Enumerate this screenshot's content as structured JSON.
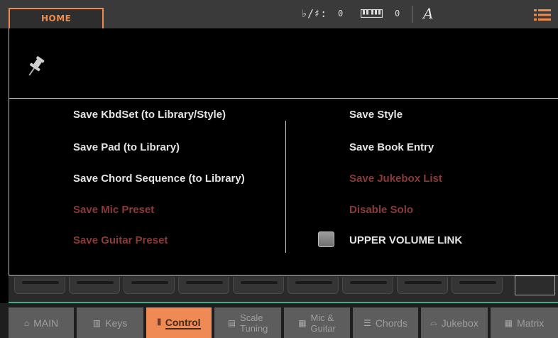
{
  "topbar": {
    "home_tab": "HOME",
    "transpose_label": "♭/♯:",
    "transpose_value": "0",
    "octave_value": "0",
    "scale_letter": "A",
    "icons": [
      "keyboard-icon",
      "menu-list-icon"
    ],
    "accent_color": "#f08b4b"
  },
  "popup": {
    "left_items": [
      {
        "label": "Save KbdSet (to Library/Style)",
        "enabled": true
      },
      {
        "label": "Save Pad (to Library)",
        "enabled": true
      },
      {
        "label": "Save Chord Sequence (to Library)",
        "enabled": true
      },
      {
        "label": "Save Mic Preset",
        "enabled": false
      },
      {
        "label": "Save Guitar Preset",
        "enabled": false
      }
    ],
    "right_items": [
      {
        "label": "Save Style",
        "enabled": true
      },
      {
        "label": "Save Book Entry",
        "enabled": true
      },
      {
        "label": "Save Jukebox List",
        "enabled": false
      },
      {
        "label": "Disable Solo",
        "enabled": false
      }
    ],
    "checkbox_item": {
      "label": "UPPER VOLUME LINK",
      "checked": false
    },
    "disabled_color": "#8a3a38"
  },
  "tabs": [
    {
      "icon": "home-icon",
      "label": "MAIN",
      "active": false
    },
    {
      "icon": "keys-icon",
      "label": "Keys",
      "active": false
    },
    {
      "icon": "control-icon",
      "label": "Control",
      "active": true
    },
    {
      "icon": "scale-tuning-icon",
      "line1": "Scale",
      "line2": "Tuning",
      "active": false
    },
    {
      "icon": "mic-guitar-icon",
      "line1": "Mic &",
      "line2": "Guitar",
      "active": false
    },
    {
      "icon": "chords-icon",
      "label": "Chords",
      "active": false
    },
    {
      "icon": "jukebox-icon",
      "label": "Jukebox",
      "active": false
    },
    {
      "icon": "matrix-icon",
      "label": "Matrix",
      "active": false
    }
  ]
}
